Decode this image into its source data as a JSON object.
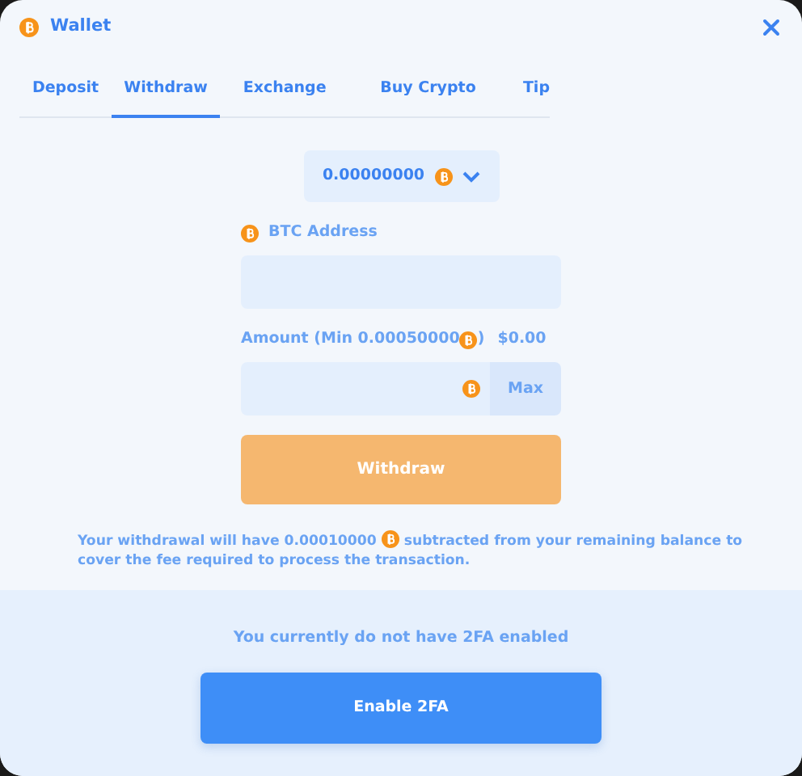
{
  "window": {
    "title": "Wallet"
  },
  "tabs": [
    {
      "label": "Deposit",
      "selected": false
    },
    {
      "label": "Withdraw",
      "selected": true
    },
    {
      "label": "Exchange",
      "selected": false
    },
    {
      "label": "Buy Crypto",
      "selected": false
    },
    {
      "label": "Tip",
      "selected": false
    }
  ],
  "currency_select": {
    "value": "0.00000000"
  },
  "address": {
    "label": "BTC Address"
  },
  "amount": {
    "label": "Amount (Min 0.00050000",
    "label_end": ")",
    "fiat": "$0.00",
    "max_button": "Max"
  },
  "withdraw_button": {
    "label": "Withdraw",
    "disabled": true
  },
  "fee_note": {
    "before": "Your withdrawal will have 0.00010000",
    "after": "subtracted from your remaining balance to",
    "line2": "cover the fee required to process the transaction."
  },
  "twofa": {
    "message": "You currently do not have 2FA enabled",
    "button": "Enable 2FA"
  }
}
